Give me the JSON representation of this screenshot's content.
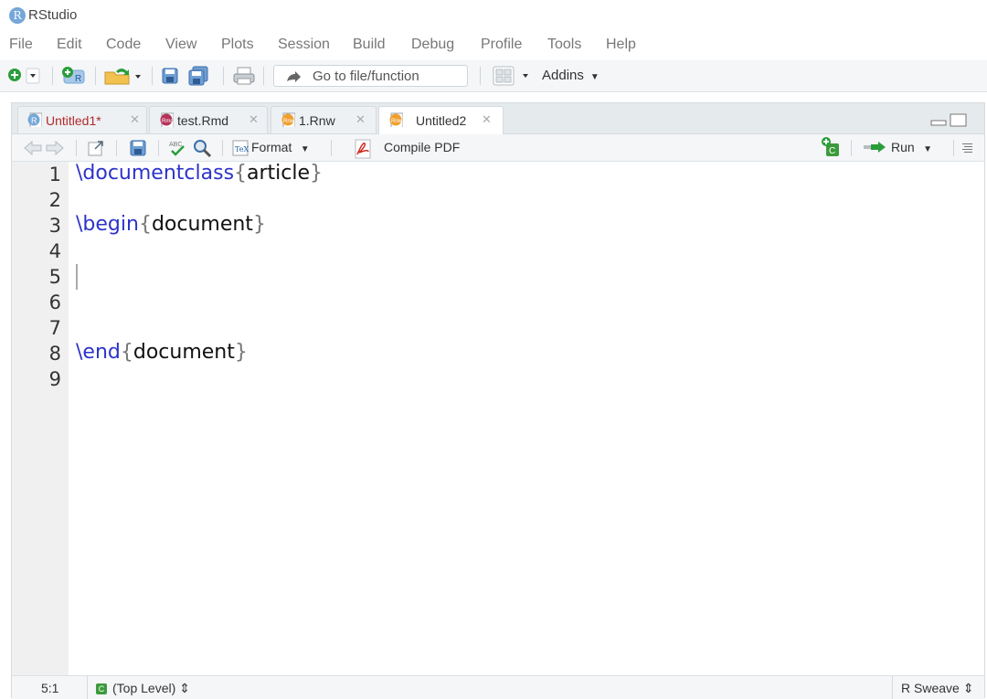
{
  "window": {
    "title": "RStudio",
    "logo_letter": "R"
  },
  "menu": [
    "File",
    "Edit",
    "Code",
    "View",
    "Plots",
    "Session",
    "Build",
    "Debug",
    "Profile",
    "Tools",
    "Help"
  ],
  "toolbar": {
    "goto_placeholder": "Go to file/function",
    "addins_label": "Addins",
    "icons": [
      "new-file-icon",
      "new-project-icon",
      "open-folder-icon",
      "save-icon",
      "save-all-icon",
      "print-icon",
      "workspace-panes-icon"
    ]
  },
  "tabs": [
    {
      "label": "Untitled1*",
      "icon": "r-script-icon",
      "icon_color": "#75a7d9",
      "modified": true
    },
    {
      "label": "test.Rmd",
      "icon": "rmd-icon",
      "icon_color": "#b5325a",
      "modified": false
    },
    {
      "label": "1.Rnw",
      "icon": "rnw-icon",
      "icon_color": "#f0a030",
      "modified": false
    },
    {
      "label": "Untitled2",
      "icon": "rnw-icon",
      "icon_color": "#f0a030",
      "modified": false,
      "active": true
    }
  ],
  "editor_toolbar": {
    "format_label": "Format",
    "compile_label": "Compile PDF",
    "run_label": "Run",
    "spellcheck_text": "ABC"
  },
  "code": {
    "line_numbers": [
      "1",
      "2",
      "3",
      "4",
      "5",
      "6",
      "7",
      "8",
      "9"
    ],
    "line1": {
      "cmd": "\\documentclass",
      "open": "{",
      "arg": "article",
      "close": "}"
    },
    "line3": {
      "cmd": "\\begin",
      "open": "{",
      "arg": "document",
      "close": "}"
    },
    "line8": {
      "cmd": "\\end",
      "open": "{",
      "arg": "document",
      "close": "}"
    }
  },
  "status": {
    "position": "5:1",
    "scope": "(Top Level)",
    "scope_badge": "C",
    "file_type": "R Sweave",
    "updown": "⇕"
  },
  "colors": {
    "accent": "#75a7d9",
    "keyword": "#2d33c9",
    "modified_tab": "#b12a2a"
  }
}
